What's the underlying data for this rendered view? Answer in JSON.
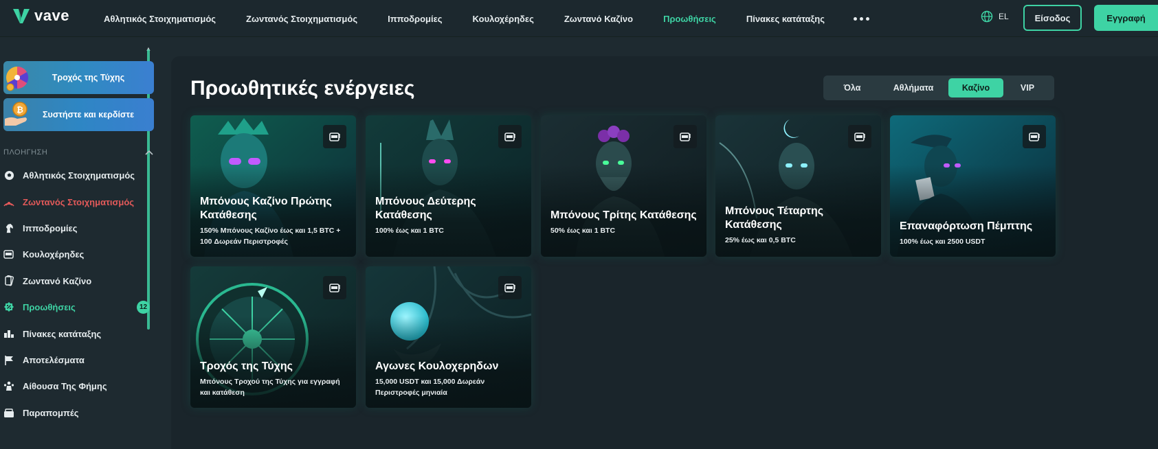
{
  "brand": {
    "name": "vave"
  },
  "nav": {
    "items": [
      {
        "label": "Αθλητικός Στοιχηματισμός",
        "active": false
      },
      {
        "label": "Ζωντανός Στοιχηματισμός",
        "active": false
      },
      {
        "label": "Ιπποδρομίες",
        "active": false
      },
      {
        "label": "Κουλοχέρηδες",
        "active": false
      },
      {
        "label": "Ζωντανό Καζίνο",
        "active": false
      },
      {
        "label": "Προωθήσεις",
        "active": true
      },
      {
        "label": "Πίνακες κατάταξης",
        "active": false
      }
    ],
    "lang": "EL",
    "login": "Είσοδος",
    "register": "Εγγραφή"
  },
  "sidebar": {
    "promos": [
      {
        "label": "Τροχός της Τύχης",
        "icon": "wheel-icon"
      },
      {
        "label": "Συστήστε και κερδίστε",
        "icon": "bitcoin-coin-icon"
      }
    ],
    "section_title": "ΠΛΟΗΓΗΣΗ",
    "items": [
      {
        "label": "Αθλητικός Στοιχηματισμός",
        "icon": "soccer-ball-icon",
        "style": ""
      },
      {
        "label": "Ζωντανός Στοιχηματισμός",
        "icon": "live-signal-icon",
        "style": "live"
      },
      {
        "label": "Ιπποδρομίες",
        "icon": "horse-icon",
        "style": ""
      },
      {
        "label": "Κουλοχέρηδες",
        "icon": "slot-machine-icon",
        "style": ""
      },
      {
        "label": "Ζωντανό Καζίνο",
        "icon": "cards-icon",
        "style": ""
      },
      {
        "label": "Προωθήσεις",
        "icon": "percent-icon",
        "style": "promo",
        "badge": "12"
      },
      {
        "label": "Πίνακες κατάταξης",
        "icon": "leaderboard-icon",
        "style": ""
      },
      {
        "label": "Αποτελέσματα",
        "icon": "flag-icon",
        "style": ""
      },
      {
        "label": "Αίθουσα Της Φήμης",
        "icon": "trophy-people-icon",
        "style": ""
      },
      {
        "label": "Παραπομπές",
        "icon": "referral-icon",
        "style": ""
      }
    ]
  },
  "main": {
    "title": "Προωθητικές ενέργειες",
    "filters": [
      {
        "label": "Όλα",
        "active": false
      },
      {
        "label": "Αθλήματα",
        "active": false
      },
      {
        "label": "Καζίνο",
        "active": true
      },
      {
        "label": "VIP",
        "active": false
      }
    ],
    "cards": [
      {
        "title": "Μπόνους Καζίνο Πρώτης Κατάθεσης",
        "sub": "150% Μπόνους Καζίνο έως και 1,5 BTC + 100 Δωρεάν Περιστροφές",
        "art": "king"
      },
      {
        "title": "Μπόνους Δεύτερης Κατάθεσης",
        "sub": "100% έως και 1 BTC",
        "art": "warrior"
      },
      {
        "title": "Μπόνους Τρίτης Κατάθεσης",
        "sub": "50% έως και 1 BTC",
        "art": "dionysus"
      },
      {
        "title": "Μπόνους Τέταρτης Κατάθεσης",
        "sub": "25% έως και 0,5 BTC",
        "art": "artemis"
      },
      {
        "title": "Επαναφόρτωση Πέμπτης",
        "sub": "100% έως και 2500 USDT",
        "art": "hermes"
      },
      {
        "title": "Τροχός της Τύχης",
        "sub": "Μπόνους Τροχού της Τύχης για εγγραφή και κατάθεση",
        "art": "wheel"
      },
      {
        "title": "Αγωνες Κουλοχερηδων",
        "sub": "15,000 USDT και 15,000 Δωρεάν Περιστροφές μηνιαία",
        "art": "orb"
      }
    ]
  },
  "colors": {
    "accent": "#3ed3a4",
    "live": "#e45a5a",
    "bg": "#1e2a30",
    "panel": "#1a252b"
  }
}
